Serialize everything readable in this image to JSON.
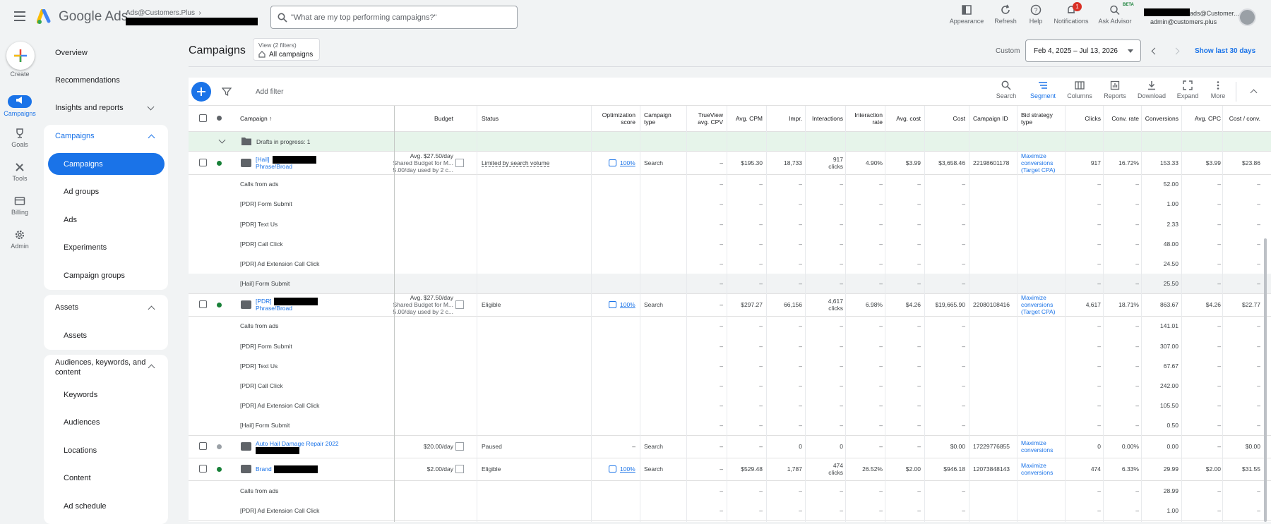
{
  "header": {
    "app_name": "Google Ads",
    "account_name": "Ads@Customers.Plus",
    "search_placeholder": "\"What are my top performing campaigns?\"",
    "icons": [
      {
        "label": "Appearance",
        "icon": "appearance-icon"
      },
      {
        "label": "Refresh",
        "icon": "refresh-icon"
      },
      {
        "label": "Help",
        "icon": "help-icon"
      },
      {
        "label": "Notifications",
        "icon": "bell-icon",
        "badge": "1"
      },
      {
        "label": "Ask Advisor",
        "icon": "advisor-icon",
        "badge": "BETA"
      }
    ],
    "user_line1": "ads@Customer...",
    "user_line2": "admin@customers.plus"
  },
  "rail": [
    {
      "label": "Create",
      "icon": "plus-icon"
    },
    {
      "label": "Campaigns",
      "icon": "megaphone-icon",
      "active": true
    },
    {
      "label": "Goals",
      "icon": "trophy-icon"
    },
    {
      "label": "Tools",
      "icon": "tools-icon"
    },
    {
      "label": "Billing",
      "icon": "card-icon"
    },
    {
      "label": "Admin",
      "icon": "gear-icon"
    }
  ],
  "nav": {
    "overview": "Overview",
    "recommendations": "Recommendations",
    "insights": "Insights and reports",
    "campaigns_header": "Campaigns",
    "campaigns_items": [
      "Campaigns",
      "Ad groups",
      "Ads",
      "Experiments",
      "Campaign groups"
    ],
    "assets_header": "Assets",
    "assets_items": [
      "Assets"
    ],
    "audiences_header": "Audiences, keywords, and content",
    "audiences_items": [
      "Keywords",
      "Audiences",
      "Locations",
      "Content",
      "Ad schedule"
    ]
  },
  "main": {
    "title": "Campaigns",
    "view_line1": "View (2 filters)",
    "view_line2": "All campaigns",
    "custom_label": "Custom",
    "date_range": "Feb 4, 2025 – Jul 13, 2026",
    "show_last": "Show last 30 days",
    "add_filter": "Add filter",
    "toolbar": [
      {
        "label": "Search",
        "icon": "search-icon"
      },
      {
        "label": "Segment",
        "icon": "segment-icon",
        "active": true
      },
      {
        "label": "Columns",
        "icon": "columns-icon"
      },
      {
        "label": "Reports",
        "icon": "reports-icon"
      },
      {
        "label": "Download",
        "icon": "download-icon"
      },
      {
        "label": "Expand",
        "icon": "expand-icon"
      },
      {
        "label": "More",
        "icon": "more-icon"
      }
    ]
  },
  "table": {
    "headers": {
      "campaign": "Campaign",
      "budget": "Budget",
      "status": "Status",
      "opt_score_1": "Optimization",
      "opt_score_2": "score",
      "camp_type_1": "Campaign",
      "camp_type_2": "type",
      "trueview_1": "TrueView",
      "trueview_2": "avg. CPV",
      "avg_cpm": "Avg. CPM",
      "impr": "Impr.",
      "interactions": "Interactions",
      "int_rate_1": "Interaction",
      "int_rate_2": "rate",
      "avg_cost": "Avg. cost",
      "cost": "Cost",
      "campaign_id": "Campaign ID",
      "bid_1": "Bid strategy",
      "bid_2": "type",
      "clicks": "Clicks",
      "conv_rate": "Conv. rate",
      "conversions": "Conversions",
      "avg_cpc": "Avg. CPC",
      "cost_conv": "Cost / conv."
    },
    "drafts_label": "Drafts in progress: 1",
    "dash": "–",
    "campaigns": [
      {
        "name_prefix": "[Hail]",
        "name_line2": "Phrase/Broad",
        "status_color": "#188038",
        "budget_1": "Avg. $27.50/day",
        "budget_2": "Shared Budget for M...",
        "budget_3": "5.00/day used by 2 c...",
        "status": "Limited by search volume",
        "opt": "100%",
        "type": "Search",
        "trueview": "–",
        "avg_cpm": "$195.30",
        "impr": "18,733",
        "interactions_1": "917",
        "interactions_2": "clicks",
        "int_rate": "4.90%",
        "avg_cost": "$3.99",
        "cost": "$3,658.46",
        "id": "22198601178",
        "bid_1": "Maximize",
        "bid_2": "conversions",
        "bid_3": "(Target CPA)",
        "clicks": "917",
        "conv_rate": "16.72%",
        "conversions": "153.33",
        "avg_cpc": "$3.99",
        "cost_conv": "$23.86",
        "subs": [
          {
            "name": "Calls from ads",
            "conv": "52.00"
          },
          {
            "name": "[PDR] Form Submit",
            "conv": "1.00"
          },
          {
            "name": "[PDR] Text Us",
            "conv": "2.33"
          },
          {
            "name": "[PDR] Call Click",
            "conv": "48.00"
          },
          {
            "name": "[PDR] Ad Extension Call Click",
            "conv": "24.50"
          },
          {
            "name": "[Hail] Form Submit",
            "conv": "25.50",
            "highlight": true
          }
        ]
      },
      {
        "name_prefix": "[PDR]",
        "name_line2": "Phrase/Broad",
        "status_color": "#188038",
        "budget_1": "Avg. $27.50/day",
        "budget_2": "Shared Budget for M...",
        "budget_3": "5.00/day used by 2 c...",
        "status": "Eligible",
        "opt": "100%",
        "type": "Search",
        "trueview": "–",
        "avg_cpm": "$297.27",
        "impr": "66,156",
        "interactions_1": "4,617",
        "interactions_2": "clicks",
        "int_rate": "6.98%",
        "avg_cost": "$4.26",
        "cost": "$19,665.90",
        "id": "22080108416",
        "bid_1": "Maximize",
        "bid_2": "conversions",
        "bid_3": "(Target CPA)",
        "clicks": "4,617",
        "conv_rate": "18.71%",
        "conversions": "863.67",
        "avg_cpc": "$4.26",
        "cost_conv": "$22.77",
        "subs": [
          {
            "name": "Calls from ads",
            "conv": "141.01"
          },
          {
            "name": "[PDR] Form Submit",
            "conv": "307.00"
          },
          {
            "name": "[PDR] Text Us",
            "conv": "67.67"
          },
          {
            "name": "[PDR] Call Click",
            "conv": "242.00"
          },
          {
            "name": "[PDR] Ad Extension Call Click",
            "conv": "105.50"
          },
          {
            "name": "[Hail] Form Submit",
            "conv": "0.50"
          }
        ]
      },
      {
        "name_prefix": "Auto Hail Damage Repair 2022",
        "name_line2": "",
        "status_color": "#9aa0a6",
        "budget_1": "$20.00/day",
        "budget_2": "",
        "budget_3": "",
        "status": "Paused",
        "opt": "",
        "opt_dash": "–",
        "type": "Search",
        "trueview": "–",
        "avg_cpm": "–",
        "impr": "0",
        "interactions_1": "0",
        "interactions_2": "",
        "int_rate": "–",
        "avg_cost": "–",
        "cost": "$0.00",
        "id": "17229776855",
        "bid_1": "Maximize",
        "bid_2": "conversions",
        "bid_3": "",
        "clicks": "0",
        "conv_rate": "0.00%",
        "conversions": "0.00",
        "avg_cpc": "–",
        "cost_conv": "$0.00",
        "subs": []
      },
      {
        "name_prefix": "Brand",
        "name_line2": "",
        "status_color": "#188038",
        "budget_1": "$2.00/day",
        "budget_2": "",
        "budget_3": "",
        "status": "Eligible",
        "opt": "100%",
        "type": "Search",
        "trueview": "–",
        "avg_cpm": "$529.48",
        "impr": "1,787",
        "interactions_1": "474",
        "interactions_2": "clicks",
        "int_rate": "26.52%",
        "avg_cost": "$2.00",
        "cost": "$946.18",
        "id": "12073848143",
        "bid_1": "Maximize",
        "bid_2": "conversions",
        "bid_3": "",
        "clicks": "474",
        "conv_rate": "6.33%",
        "conversions": "29.99",
        "avg_cpc": "$2.00",
        "cost_conv": "$31.55",
        "subs": [
          {
            "name": "Calls from ads",
            "conv": "28.99"
          },
          {
            "name": "[PDR] Ad Extension Call Click",
            "conv": "1.00"
          }
        ]
      }
    ]
  }
}
